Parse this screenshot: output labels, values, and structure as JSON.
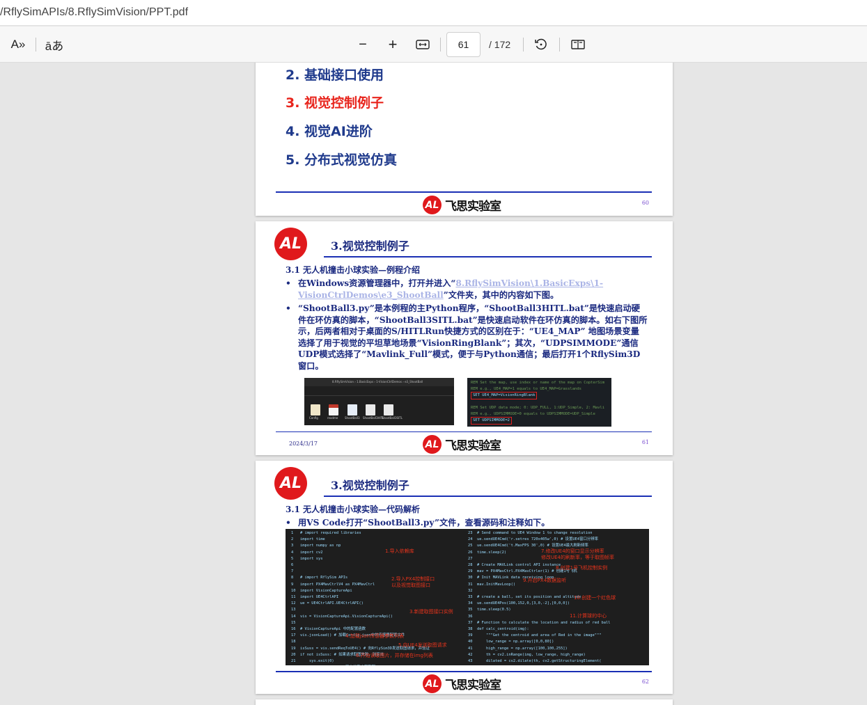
{
  "address": {
    "path": "/RflySimAPIs/8.RflySimVision/PPT.pdf"
  },
  "toolbar": {
    "read_aloud_icon": "A»",
    "translate_icon": "āあ",
    "zoom_out": "−",
    "zoom_in": "+",
    "current_page": "61",
    "total_pages": "/ 172"
  },
  "page60": {
    "toc": [
      "2. 基础接口使用",
      "3. 视觉控制例子",
      "4. 视觉AI进阶",
      "5. 分布式视觉仿真"
    ],
    "logo_mark": "AL",
    "logo_text": "飞思实验室",
    "page_number": "60"
  },
  "page61": {
    "title": "3.视觉控制例子",
    "subtitle": "3.1 无人机撞击小球实验—例程介绍",
    "bullet1_pre": "在Windows资源管理器中，打开并进入“",
    "bullet1_link": "8.RflySimVision\\1.BasicExps\\1-VisionCtrlDemos\\e3_ShootBall",
    "bullet1_post": "”文件夹，其中的内容如下图。",
    "bullet2": "“ShootBall3.py”是本例程的主Python程序，“ShootBall3HITL.bat”是快速启动硬件在环仿真的脚本，“ShootBall3SITL.bat”是快速启动软件在环仿真的脚本。如右下图所示，后两者相对于桌面的S/HITLRun快捷方式的区别在于：“UE4_MAP” 地图场景变量选择了用于视觉的平坦草地场景“VisionRingBlank”；其次，“UDPSIMMODE”通信UDP模式选择了“Mavlink_Full”模式，便于与Python通信；最后打开1个RflySim3D窗口。",
    "explorer_path": "8.RflySimVision  ›  1.BasicExps  ›  1-VisionCtrlDemos  ›  e3_ShootBall",
    "explorer_files": [
      "Config",
      "readme",
      "ShootBall3",
      "ShootBall3HITL",
      "ShootBall3SITL"
    ],
    "bat_lines": [
      "REM Set the map, use index or name of the map on CopterSim",
      "REM e.g., UE4_MAP=1 equals to UE4_MAP=Grasslands",
      "SET UE4_MAP=VisionRingBlank",
      "REM Set UDP data mode; 0: UDP_FULL, 1:UDP_Simple, 2: Mavli",
      "REM e.g., UDPSIMMODE=0 equals to UDPSIMMODE=UDP_Simple",
      "SET UDPSIMMODE=2"
    ],
    "date": "2024/3/17",
    "page_number": "61"
  },
  "page62": {
    "title": "3.视觉控制例子",
    "subtitle": "3.1 无人机撞击小球实验—代码解析",
    "bullet1": "用VS Code打开“ShootBall3.py”文件，查看源码和注释如下。",
    "code_left": "1   # import required libraries\n2   import time\n3   import numpy as np\n4   import cv2\n5   import sys\n6\n7\n8   # import RflySim APIs\n9   import PX4MavCtrlV4 as PX4MavCtrl\n10  import VisionCaptureApi\n11  import UE4CtrlAPI\n12  ue = UE4CtrlAPI.UE4CtrlAPI()\n13\n14  vis = VisionCaptureApi.VisionCaptureApi()\n15\n16  # VisionCaptureApi 中的配置函数\n17  vis.jsonLoad() # 加载Config.json中的传感器配置文件\n18\n19  isSuss = vis.sendReqToUE4() # 向RflySim3D发送取图请求，并验证\n20  if not isSuss: # 如果请求取图失败，则退出\n21      sys.exit(0)\n22  vis.startImgCap() # 开启共享内存取图",
    "code_right": "23  # Send command to UE4 Window 1 to change resolution\n24  ue.sendUE4Cmd('r.setres 720x405w',0) # 设置UE4窗口分辨率\n25  ue.sendUE4Cmd('t.MaxFPS 30',0) # 设置UE4最大刷新频率\n26  time.sleep(2)\n27\n28  # Create MAVLink control API instance\n29  mav = PX4MavCtrl.PX4MavCtrler(1) # 创建1号飞机\n30  # Init MAVLink data receiving loop\n31  mav.InitMavLoop()\n32\n33  # create a ball, set its position and altitude\n34  ue.sendUE4Pos(100,152,0,[3,0,-2],[0,0,0])\n35  time.sleep(0.5)\n36\n37  # Function to calculate the location and radius of red ball\n38  def calc_centroid(img):\n39      \"\"\"Get the centroid and area of Red in the image\"\"\"\n40      low_range = np.array([0,0,80])\n41      high_range = np.array([100,100,255])\n42      th = cv2.inRange(img, low_range, high_range)\n43      dilated = cv2.dilate(th, cv2.getStructuringElement(\n44          cv2.MORPH_ELLIPSE, (3, 3)), iterations=2)\n45      cv2.imshow(\"dilated\", dilated)\n46      cv2.waitKey(1)",
    "annotations": [
      "1.导入依赖库",
      "2.导入PX4控制接口\n以及视觉取图接口",
      "3.新建取图接口实例",
      "4.加载json传感器参数列表",
      "5.向UE4发送取图请求",
      "6.开始读取图片，并存储在img列表",
      "7.修改UE4的窗口显示分辨率\n修改UE4的刷新率，等于取图帧率",
      "8.创建1号飞机控制实例",
      "9.开启PX4数据监听",
      "10.创建一个红色球",
      "11.计算球的中心"
    ],
    "logo_mark": "AL",
    "logo_text": "飞思实验室",
    "page_number": "62"
  }
}
